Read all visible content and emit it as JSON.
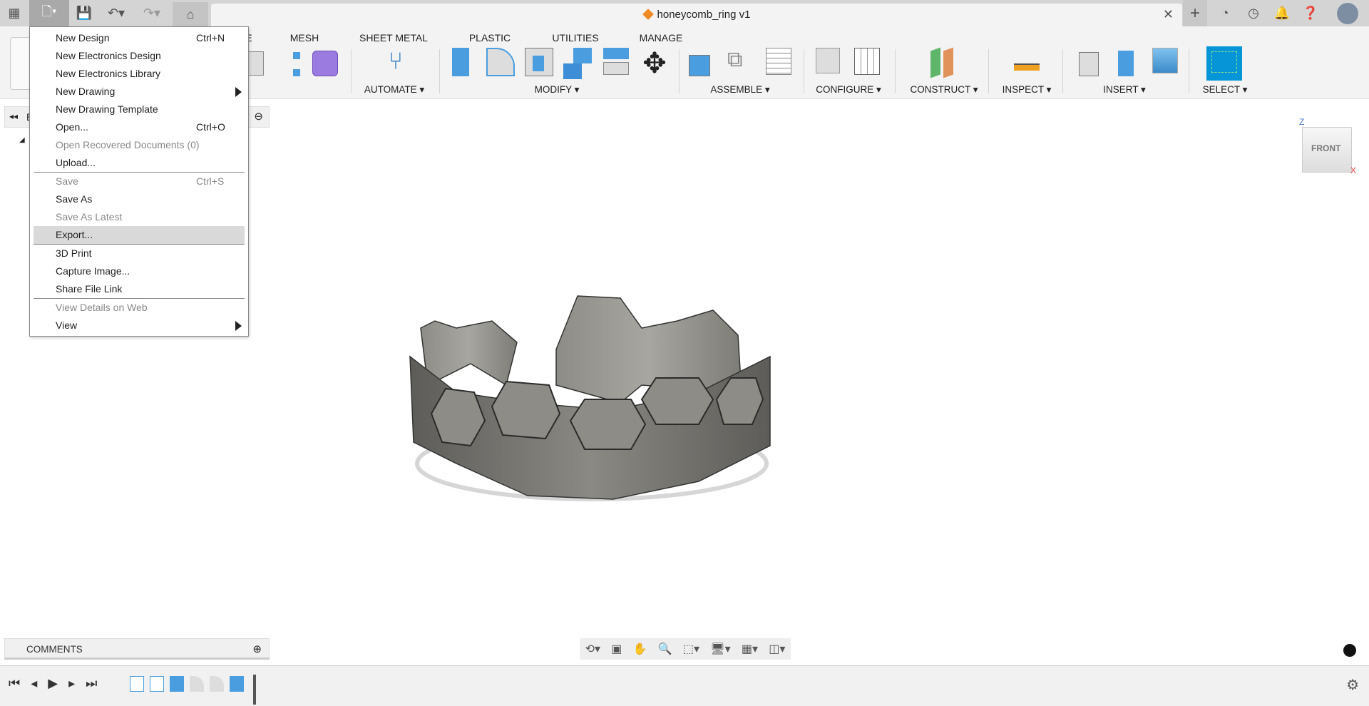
{
  "app": {
    "document_title": "honeycomb_ring v1",
    "accent": "#0696d7"
  },
  "tabs": [
    {
      "label": "MESH"
    },
    {
      "label": "SHEET METAL"
    },
    {
      "label": "PLASTIC"
    },
    {
      "label": "UTILITIES"
    },
    {
      "label": "MANAGE"
    }
  ],
  "partial_tab": "E",
  "groups": [
    {
      "label": "AUTOMATE ▾"
    },
    {
      "label": "MODIFY ▾"
    },
    {
      "label": "ASSEMBLE ▾"
    },
    {
      "label": "CONFIGURE ▾"
    },
    {
      "label": "CONSTRUCT ▾"
    },
    {
      "label": "INSPECT ▾"
    },
    {
      "label": "INSERT ▾"
    },
    {
      "label": "SELECT ▾"
    }
  ],
  "file_menu": {
    "items": [
      {
        "label": "New Design",
        "shortcut": "Ctrl+N"
      },
      {
        "label": "New Electronics Design"
      },
      {
        "label": "New Electronics Library"
      },
      {
        "label": "New Drawing",
        "submenu": true
      },
      {
        "label": "New Drawing Template"
      },
      {
        "label": "Open...",
        "shortcut": "Ctrl+O"
      },
      {
        "label": "Open Recovered Documents (0)",
        "disabled": true
      },
      {
        "label": "Upload...",
        "separator_after": true
      },
      {
        "label": "Save",
        "shortcut": "Ctrl+S",
        "disabled": true
      },
      {
        "label": "Save As"
      },
      {
        "label": "Save As Latest",
        "disabled": true
      },
      {
        "label": "Export...",
        "highlighted": true,
        "separator_after": true
      },
      {
        "label": "3D Print"
      },
      {
        "label": "Capture Image..."
      },
      {
        "label": "Share File Link",
        "separator_after": true
      },
      {
        "label": "View Details on Web",
        "disabled": true
      },
      {
        "label": "View",
        "submenu": true
      }
    ]
  },
  "browser": {
    "label": "B"
  },
  "comments": {
    "label": "COMMENTS"
  },
  "viewcube": {
    "face": "FRONT",
    "axis_z": "Z",
    "axis_x": "X"
  }
}
